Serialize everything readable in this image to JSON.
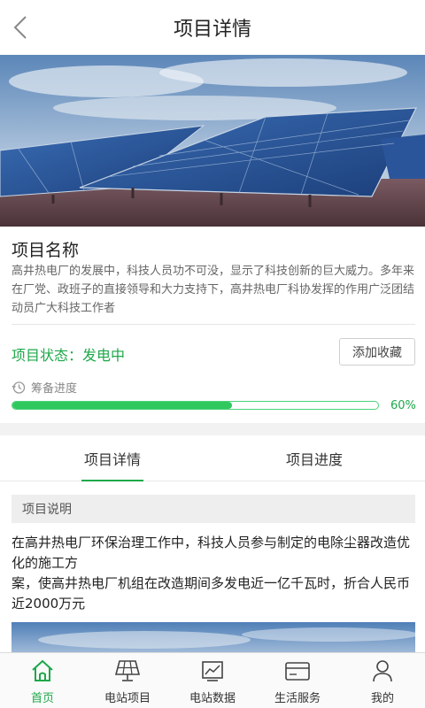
{
  "header": {
    "title": "项目详情",
    "back_icon": "chevron-left-icon"
  },
  "project": {
    "name": "项目名称",
    "description": "高井热电厂的发展中，科技人员功不可没，显示了科技创新的巨大威力。多年来在厂党、政班子的直接领导和大力支持下，高井热电厂科协发挥的作用广泛团结动员广大科技工作者",
    "status": "项目状态：发电中",
    "favorite_button": "添加收藏",
    "progress_label": "筹备进度",
    "progress_value": 0.6,
    "progress_text": "60%"
  },
  "tabs": [
    {
      "label": "项目详情",
      "active": true
    },
    {
      "label": "项目进度",
      "active": false
    }
  ],
  "detail": {
    "section_title": "项目说明",
    "body": "在高井热电厂环保治理工作中，科技人员参与制定的电除尘器改造优化的施工方\n案，使高井热电厂机组在改造期间多发电近一亿千瓦时，折合人民币近2000万元"
  },
  "tabbar": [
    {
      "label": "首页",
      "icon": "home-icon",
      "active": true
    },
    {
      "label": "电站项目",
      "icon": "solar-panel-icon",
      "active": false
    },
    {
      "label": "电站数据",
      "icon": "chart-icon",
      "active": false
    },
    {
      "label": "生活服务",
      "icon": "card-icon",
      "active": false
    },
    {
      "label": "我的",
      "icon": "user-icon",
      "active": false
    }
  ],
  "colors": {
    "accent": "#1ea84a",
    "progress": "#2fc85e"
  }
}
